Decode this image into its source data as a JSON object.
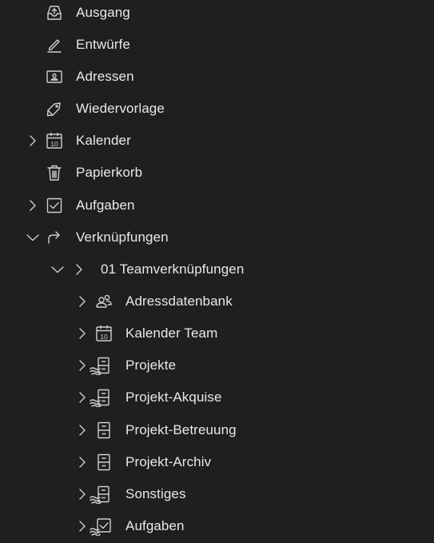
{
  "folders": {
    "ausgang": "Ausgang",
    "entwuerfe": "Entwürfe",
    "adressen": "Adressen",
    "wiedervorlage": "Wiedervorlage",
    "kalender": "Kalender",
    "papierkorb": "Papierkorb",
    "aufgaben": "Aufgaben",
    "verknuepfungen": "Verknüpfungen",
    "teamverknuepfungen": "01 Teamverknüpfungen",
    "adressdatenbank": "Adressdatenbank",
    "kalender_team": "Kalender Team",
    "projekte": "Projekte",
    "projekt_akquise": "Projekt-Akquise",
    "projekt_betreuung": "Projekt-Betreuung",
    "projekt_archiv": "Projekt-Archiv",
    "sonstiges": "Sonstiges",
    "team_aufgaben": "Aufgaben"
  },
  "calendar_icon_day": "10",
  "icons": {
    "ausgang": "outbox-icon",
    "entwuerfe": "pencil-icon",
    "adressen": "contact-card-icon",
    "wiedervorlage": "tag-icon",
    "kalender": "calendar-icon",
    "papierkorb": "trash-icon",
    "aufgaben": "checkbox-icon",
    "verknuepfungen": "shortcut-arrow-icon",
    "adressdatenbank": "people-icon",
    "projekte": "shared-cabinet-icon",
    "projekt_akquise": "shared-cabinet-icon",
    "projekt_betreuung": "cabinet-icon",
    "projekt_archiv": "cabinet-icon",
    "sonstiges": "shared-cabinet-icon",
    "team_aufgaben": "shared-checkbox-icon"
  },
  "colors": {
    "background": "#1f1f1f",
    "text": "#e8e8e8",
    "icon": "#cfcfcf"
  }
}
